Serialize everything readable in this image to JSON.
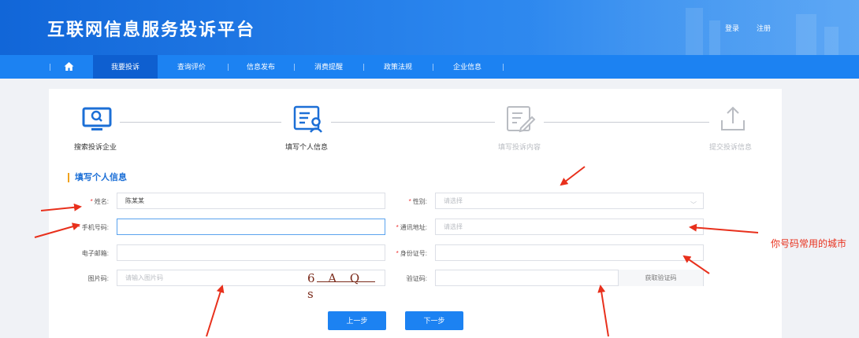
{
  "header": {
    "title": "互联网信息服务投诉平台",
    "login": "登录",
    "register": "注册"
  },
  "nav": {
    "home_icon": "home-icon",
    "items": [
      "我要投诉",
      "查询评价",
      "信息发布",
      "消费提醒",
      "政策法规",
      "企业信息"
    ],
    "active_index": 0
  },
  "steps": [
    {
      "label": "搜索投诉企业",
      "icon": "search-monitor-icon",
      "state": "done"
    },
    {
      "label": "填写个人信息",
      "icon": "person-form-icon",
      "state": "current"
    },
    {
      "label": "填写投诉内容",
      "icon": "edit-document-icon",
      "state": "pending"
    },
    {
      "label": "提交投诉信息",
      "icon": "upload-icon",
      "state": "pending"
    }
  ],
  "section_title": "填写个人信息",
  "form": {
    "name": {
      "label": "姓名:",
      "required": true,
      "value": "陈某某"
    },
    "gender": {
      "label": "性别:",
      "required": true,
      "placeholder": "请选择"
    },
    "phone": {
      "label": "手机号码:",
      "required": true,
      "value": ""
    },
    "address": {
      "label": "通讯地址:",
      "required": true,
      "placeholder": "请选择"
    },
    "email": {
      "label": "电子邮箱:",
      "required": false,
      "value": ""
    },
    "id_number": {
      "label": "身份证号:",
      "required": true,
      "value": ""
    },
    "captcha": {
      "label": "图片码:",
      "required": false,
      "placeholder": "请输入图片码",
      "image_text": "6 A Q s"
    },
    "sms_code": {
      "label": "验证码:",
      "required": false,
      "value": "",
      "button": "获取验证码"
    }
  },
  "buttons": {
    "prev": "上一步",
    "next": "下一步"
  },
  "annotation": {
    "text": "你号码常用的城市",
    "color": "#e8301c"
  },
  "colors": {
    "header_blue": "#1166d8",
    "nav_blue": "#1c82f2",
    "accent_orange": "#f0a21c",
    "section_blue": "#1c6fd6"
  }
}
